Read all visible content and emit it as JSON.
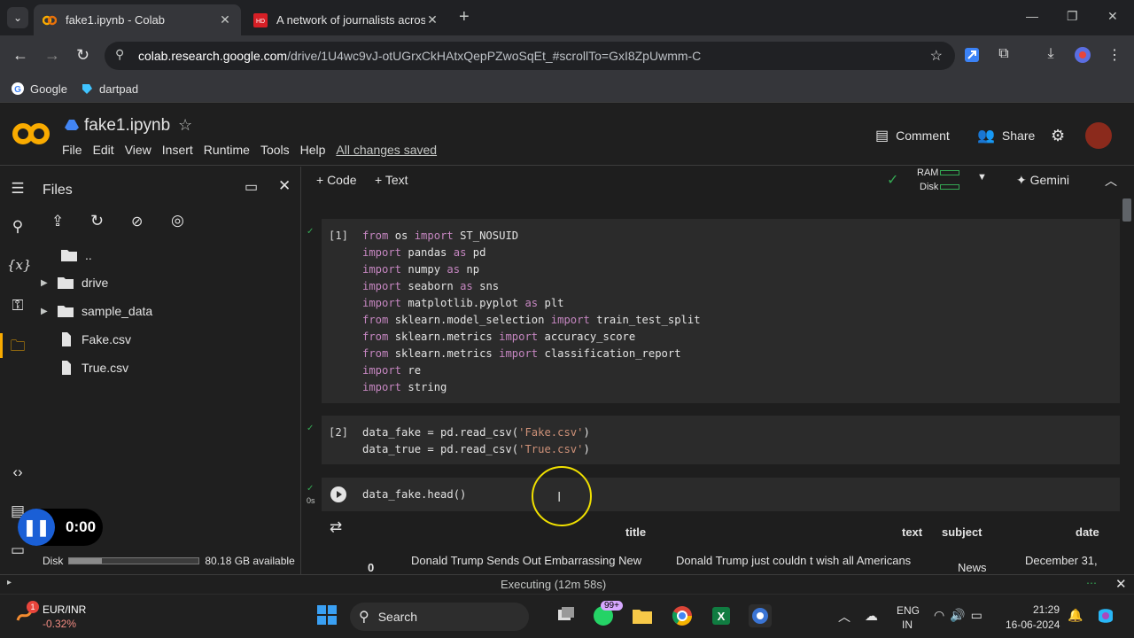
{
  "browser": {
    "tabs": [
      {
        "title": "fake1.ipynb - Colab",
        "active": true
      },
      {
        "title": "A network of journalists across",
        "active": false
      }
    ],
    "url_host": "colab.research.google.com",
    "url_rest": "/drive/1U4wc9vJ-otUGrxCkHAtxQepPZwoSqEt_#scrollTo=GxI8ZpUwmm-C",
    "bookmarks": [
      "Google",
      "dartpad"
    ]
  },
  "colab": {
    "notebook_title": "fake1.ipynb",
    "menu": [
      "File",
      "Edit",
      "View",
      "Insert",
      "Runtime",
      "Tools",
      "Help"
    ],
    "saved_status": "All changes saved",
    "comment_label": "Comment",
    "share_label": "Share",
    "add_code_label": "+ Code",
    "add_text_label": "+ Text",
    "ram_label": "RAM",
    "disk_label": "Disk",
    "gemini_label": "Gemini"
  },
  "files_panel": {
    "title": "Files",
    "items": [
      {
        "name": "..",
        "type": "folder-up"
      },
      {
        "name": "drive",
        "type": "folder"
      },
      {
        "name": "sample_data",
        "type": "folder"
      },
      {
        "name": "Fake.csv",
        "type": "file"
      },
      {
        "name": "True.csv",
        "type": "file"
      }
    ],
    "disk_label": "Disk",
    "disk_available": "80.18 GB available",
    "disk_used_fraction": 0.25
  },
  "cells": [
    {
      "exec": "[1]",
      "lines": [
        "from os import ST_NOSUID",
        "import pandas as pd",
        "import numpy as np",
        "import seaborn as sns",
        "import matplotlib.pyplot as plt",
        "from sklearn.model_selection import train_test_split",
        "from sklearn.metrics import accuracy_score",
        "from sklearn.metrics import classification_report",
        "import re",
        "import string"
      ]
    },
    {
      "exec": "[2]",
      "lines": [
        "data_fake = pd.read_csv('Fake.csv')",
        "data_true = pd.read_csv('True.csv')"
      ]
    },
    {
      "exec": "",
      "time": "0s",
      "lines": [
        "data_fake.head()"
      ]
    }
  ],
  "output_table": {
    "headers": [
      "title",
      "text",
      "subject",
      "date"
    ],
    "row": {
      "index": "0",
      "title": "Donald Trump Sends Out Embarrassing New",
      "text": "Donald Trump just couldn t wish all Americans",
      "subject": "News",
      "date": "December 31,"
    }
  },
  "status": {
    "text": "Executing (12m 58s)"
  },
  "recorder": {
    "time": "0:00"
  },
  "taskbar": {
    "currency": "EUR/INR",
    "currency_change": "-0.32%",
    "notif_badge": "1",
    "search": "Search",
    "whatsapp_badge": "99+",
    "lang": "ENG",
    "region": "IN",
    "time": "21:29",
    "date": "16-06-2024"
  },
  "colors": {
    "accent_orange": "#f9ab00",
    "check_green": "#34a853",
    "keyword": "#c586c0",
    "string": "#ce9178"
  }
}
